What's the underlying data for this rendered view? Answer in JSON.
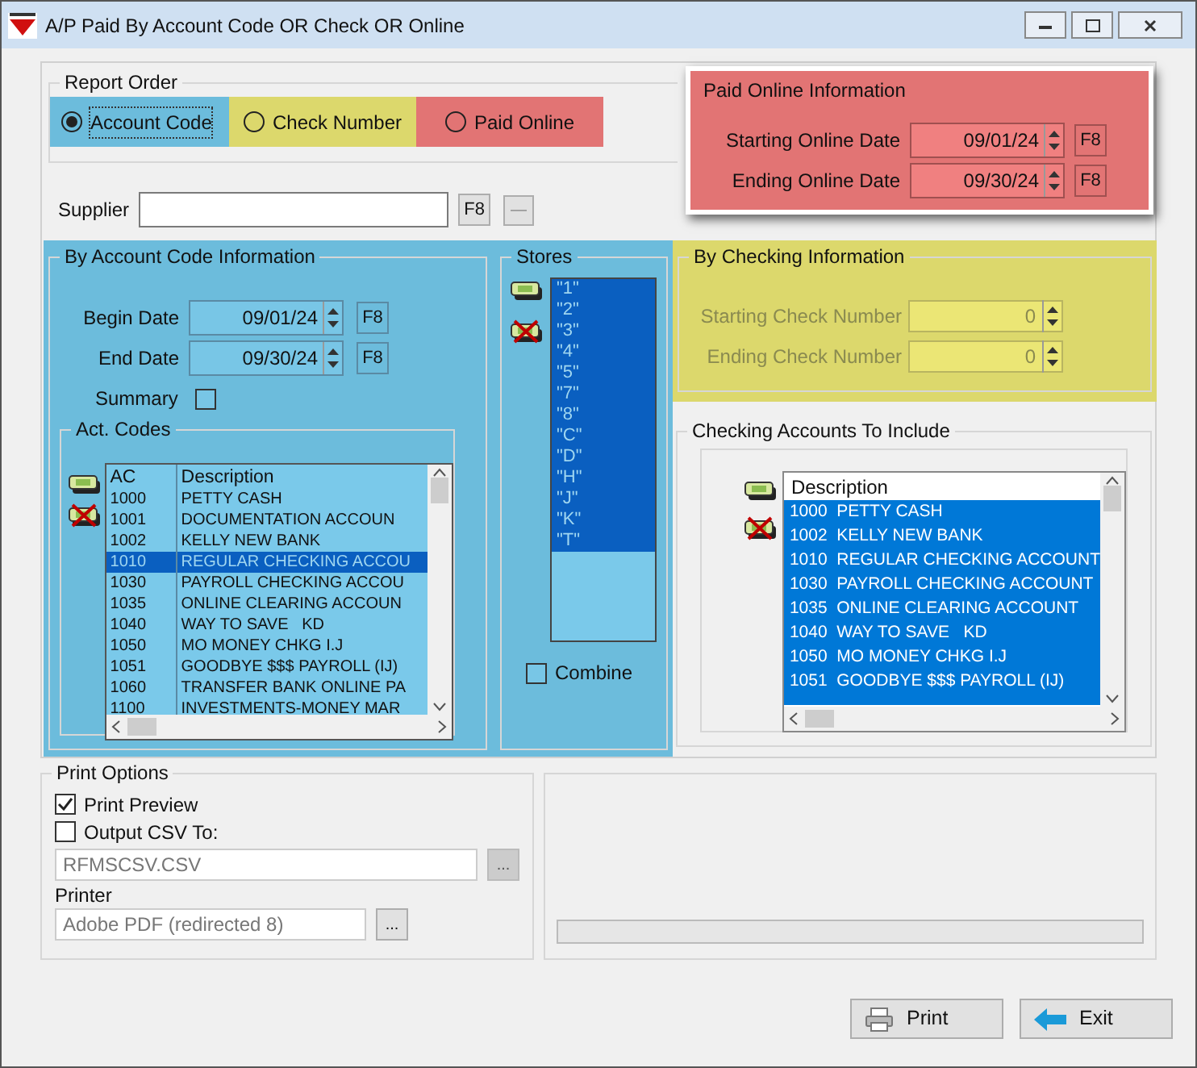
{
  "window": {
    "title": "A/P Paid By Account Code OR Check OR Online"
  },
  "report_order": {
    "title": "Report Order",
    "options": [
      {
        "label": "Account Code",
        "selected": true,
        "color": "#6cbcdc"
      },
      {
        "label": "Check Number",
        "selected": false,
        "color": "#dcd86c"
      },
      {
        "label": "Paid Online",
        "selected": false,
        "color": "#e27474"
      }
    ]
  },
  "paid_online": {
    "title": "Paid Online Information",
    "fields": [
      {
        "label": "Starting Online Date",
        "value": "09/01/24",
        "button": "F8"
      },
      {
        "label": "Ending Online Date",
        "value": "09/30/24",
        "button": "F8"
      }
    ]
  },
  "supplier": {
    "label": "Supplier",
    "button": "F8",
    "clear_button": "—"
  },
  "account_code": {
    "title": "By Account Code Information",
    "fields": [
      {
        "label": "Begin Date",
        "value": "09/01/24",
        "button": "F8"
      },
      {
        "label": "End Date",
        "value": "09/30/24",
        "button": "F8"
      }
    ],
    "summary": {
      "label": "Summary",
      "checked": false
    },
    "act_codes": {
      "title": "Act. Codes",
      "columns": [
        "AC",
        "Description"
      ],
      "rows": [
        {
          "ac": "1000",
          "description": "PETTY CASH",
          "selected": false
        },
        {
          "ac": "1001",
          "description": "DOCUMENTATION ACCOUN",
          "selected": false
        },
        {
          "ac": "1002",
          "description": "KELLY NEW BANK",
          "selected": false
        },
        {
          "ac": "1010",
          "description": "REGULAR CHECKING ACCOU",
          "selected": true
        },
        {
          "ac": "1030",
          "description": "PAYROLL CHECKING ACCOU",
          "selected": false
        },
        {
          "ac": "1035",
          "description": "ONLINE CLEARING ACCOUN",
          "selected": false
        },
        {
          "ac": "1040",
          "description": "WAY TO SAVE   KD",
          "selected": false
        },
        {
          "ac": "1050",
          "description": "MO MONEY CHKG I.J",
          "selected": false
        },
        {
          "ac": "1051",
          "description": "GOODBYE $$$ PAYROLL (IJ)",
          "selected": false
        },
        {
          "ac": "1060",
          "description": "TRANSFER BANK ONLINE PA",
          "selected": false
        },
        {
          "ac": "1100",
          "description": "INVESTMENTS-MONEY MAR",
          "selected": false
        }
      ]
    }
  },
  "stores": {
    "title": "Stores",
    "items": [
      {
        "label": "\"1\"",
        "selected": true
      },
      {
        "label": "\"2\"",
        "selected": true
      },
      {
        "label": "\"3\"",
        "selected": true
      },
      {
        "label": "\"4\"",
        "selected": true
      },
      {
        "label": "\"5\"",
        "selected": true
      },
      {
        "label": "\"7\"",
        "selected": true
      },
      {
        "label": "\"8\"",
        "selected": true
      },
      {
        "label": "\"C\"",
        "selected": true
      },
      {
        "label": "\"D\"",
        "selected": true
      },
      {
        "label": "\"H\"",
        "selected": true
      },
      {
        "label": "\"J\"",
        "selected": true
      },
      {
        "label": "\"K\"",
        "selected": true
      },
      {
        "label": "\"T\"",
        "selected": true
      }
    ],
    "combine": {
      "label": "Combine",
      "checked": false
    }
  },
  "checking": {
    "title": "By Checking Information",
    "fields": [
      {
        "label": "Starting Check Number",
        "value": "0",
        "disabled": true
      },
      {
        "label": "Ending Check Number",
        "value": "0",
        "disabled": true
      }
    ]
  },
  "checking_accounts": {
    "title": "Checking Accounts To Include",
    "column": "Description",
    "rows": [
      {
        "text": "1000  PETTY CASH",
        "selected": true
      },
      {
        "text": "1002  KELLY NEW BANK",
        "selected": true
      },
      {
        "text": "1010  REGULAR CHECKING ACCOUNT",
        "selected": true
      },
      {
        "text": "1030  PAYROLL CHECKING ACCOUNT",
        "selected": true
      },
      {
        "text": "1035  ONLINE CLEARING ACCOUNT",
        "selected": true
      },
      {
        "text": "1040  WAY TO SAVE   KD",
        "selected": true
      },
      {
        "text": "1050  MO MONEY CHKG I.J",
        "selected": true
      },
      {
        "text": "1051  GOODBYE $$$ PAYROLL (IJ)",
        "selected": true
      }
    ]
  },
  "print_options": {
    "title": "Print Options",
    "checkboxes": [
      {
        "label": "Print Preview",
        "checked": true
      },
      {
        "label": "Output CSV To:",
        "checked": false
      }
    ],
    "csv_path": "RFMSCSV.CSV",
    "csv_button": "...",
    "printer_label": "Printer",
    "printer": "Adobe PDF (redirected 8)",
    "printer_button": "..."
  },
  "progress_bar": {
    "level": 0
  },
  "buttons": [
    {
      "label": "Print",
      "kind": "print"
    },
    {
      "label": "Exit",
      "kind": "exit"
    }
  ]
}
